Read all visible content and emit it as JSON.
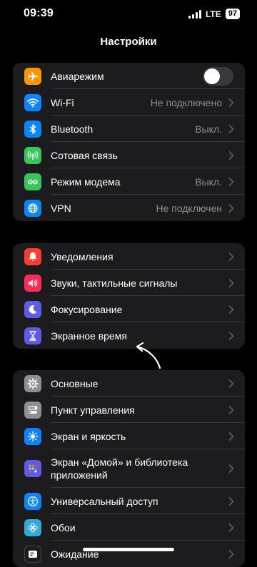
{
  "status": {
    "time": "09:39",
    "network": "LTE",
    "battery": "97"
  },
  "header": {
    "title": "Настройки"
  },
  "group1": [
    {
      "label": "Авиарежим",
      "icon": "airplane-icon",
      "color": "#ff9500",
      "toggle": false
    },
    {
      "label": "Wi-Fi",
      "icon": "wifi-icon",
      "color": "#0a84ff",
      "value": "Не подключено"
    },
    {
      "label": "Bluetooth",
      "icon": "bluetooth-icon",
      "color": "#0a84ff",
      "value": "Выкл."
    },
    {
      "label": "Сотовая связь",
      "icon": "cellular-icon",
      "color": "#34c759"
    },
    {
      "label": "Режим модема",
      "icon": "hotspot-icon",
      "color": "#34c759",
      "value": "Выкл."
    },
    {
      "label": "VPN",
      "icon": "globe-icon",
      "color": "#0a84ff",
      "value": "Не подключен"
    }
  ],
  "group2": [
    {
      "label": "Уведомления",
      "icon": "bell-icon",
      "color": "#ff3b30"
    },
    {
      "label": "Звуки, тактильные сигналы",
      "icon": "speaker-icon",
      "color": "#ff2d55"
    },
    {
      "label": "Фокусирование",
      "icon": "moon-icon",
      "color": "#5e5ce6"
    },
    {
      "label": "Экранное время",
      "icon": "hourglass-icon",
      "color": "#5e5ce6"
    }
  ],
  "group3": [
    {
      "label": "Основные",
      "icon": "gear-icon",
      "color": "#8e8e93"
    },
    {
      "label": "Пункт управления",
      "icon": "toggles-icon",
      "color": "#8e8e93"
    },
    {
      "label": "Экран и яркость",
      "icon": "sun-icon",
      "color": "#0a84ff"
    },
    {
      "label": "Экран «Домой» и библиотека приложений",
      "icon": "home-grid-icon",
      "color": "#5e5ce6"
    },
    {
      "label": "Универсальный доступ",
      "icon": "accessibility-icon",
      "color": "#0a84ff"
    },
    {
      "label": "Обои",
      "icon": "flower-icon",
      "color": "#34aadc"
    },
    {
      "label": "Ожидание",
      "icon": "standby-icon",
      "color": "#1c1c1e"
    }
  ]
}
